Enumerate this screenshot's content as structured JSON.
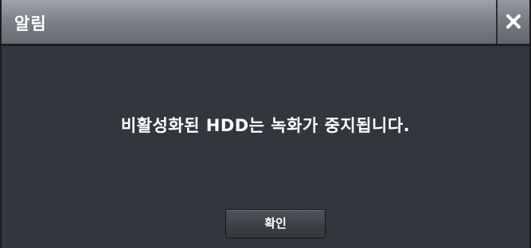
{
  "dialog": {
    "title": "알림",
    "close_icon": "close-icon",
    "message": "비활성화된 HDD는 녹화가 중지됩니다.",
    "confirm_label": "확인"
  },
  "colors": {
    "titlebar": "#7f8389",
    "body": "#32363d",
    "text": "#ffffff"
  }
}
